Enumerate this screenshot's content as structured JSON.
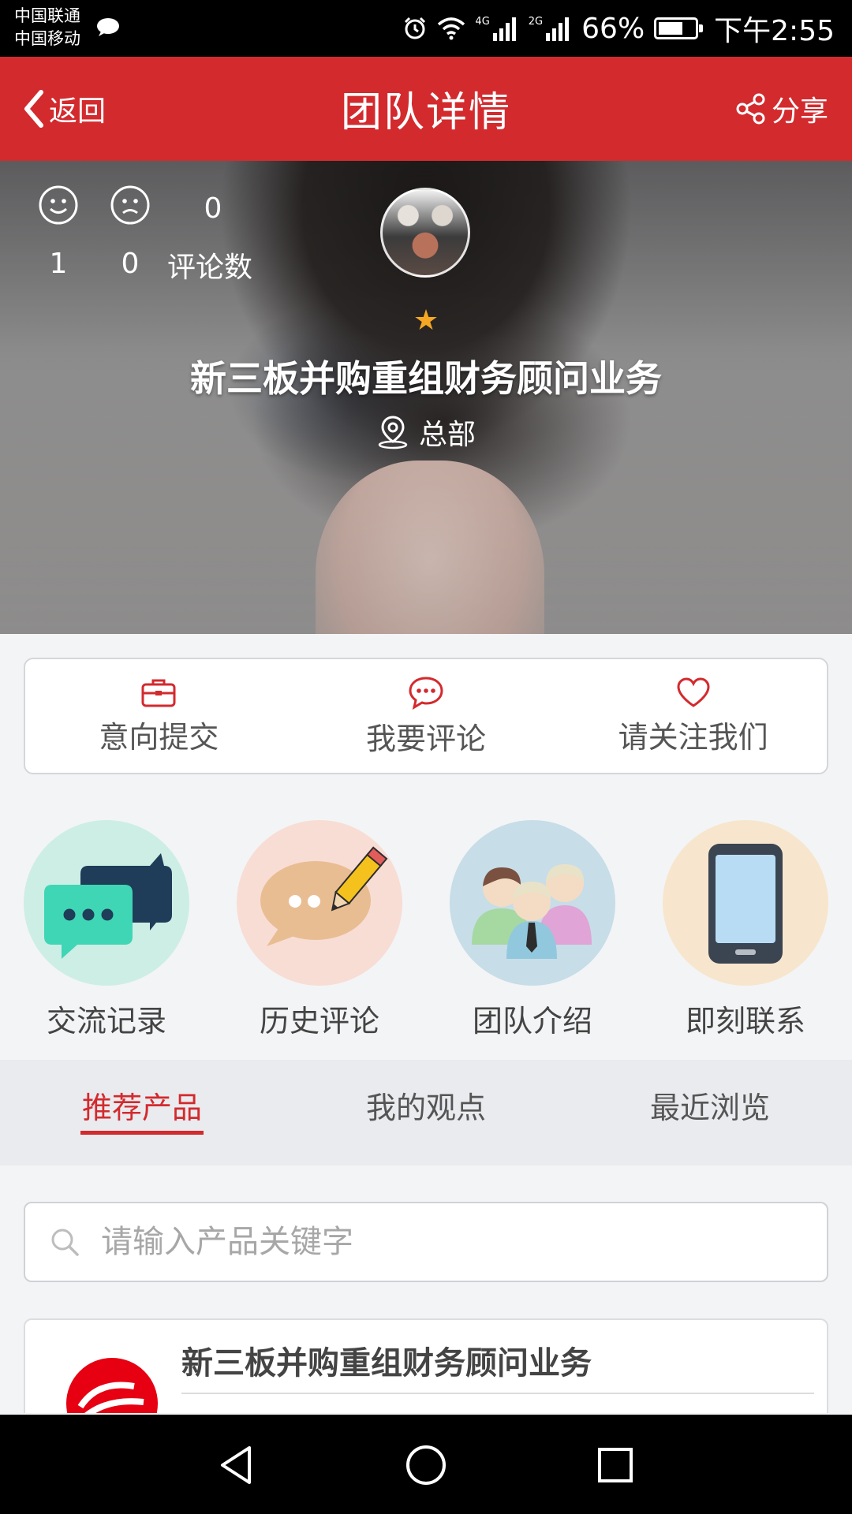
{
  "status_bar": {
    "carrier_1": "中国联通",
    "carrier_2": "中国移动",
    "network_1": "4G",
    "network_2": "2G",
    "battery": "66%",
    "time": "下午2:55"
  },
  "header": {
    "back_label": "返回",
    "title": "团队详情",
    "share_label": "分享",
    "bg_color": "#d32a2e"
  },
  "hero": {
    "likes": "1",
    "dislikes": "0",
    "comment_count": "0",
    "comment_label": "评论数",
    "star": "★",
    "team_name": "新三板并购重组财务顾问业务",
    "location": "总部"
  },
  "actions": [
    {
      "label": "意向提交",
      "icon": "briefcase-icon"
    },
    {
      "label": "我要评论",
      "icon": "chat-bubble-icon"
    },
    {
      "label": "请关注我们",
      "icon": "heart-icon"
    }
  ],
  "quick_links": [
    {
      "label": "交流记录",
      "icon": "chat-icon",
      "bg": "#cdeee4"
    },
    {
      "label": "历史评论",
      "icon": "pencil-comment-icon",
      "bg": "#f8ddd5"
    },
    {
      "label": "团队介绍",
      "icon": "team-icon",
      "bg": "#c7dde8"
    },
    {
      "label": "即刻联系",
      "icon": "phone-icon",
      "bg": "#f7e6cd"
    }
  ],
  "tabs": [
    {
      "label": "推荐产品",
      "active": true
    },
    {
      "label": "我的观点",
      "active": false
    },
    {
      "label": "最近浏览",
      "active": false
    }
  ],
  "search": {
    "placeholder": "请输入产品关键字"
  },
  "products": [
    {
      "title": "新三板并购重组财务顾问业务"
    }
  ]
}
